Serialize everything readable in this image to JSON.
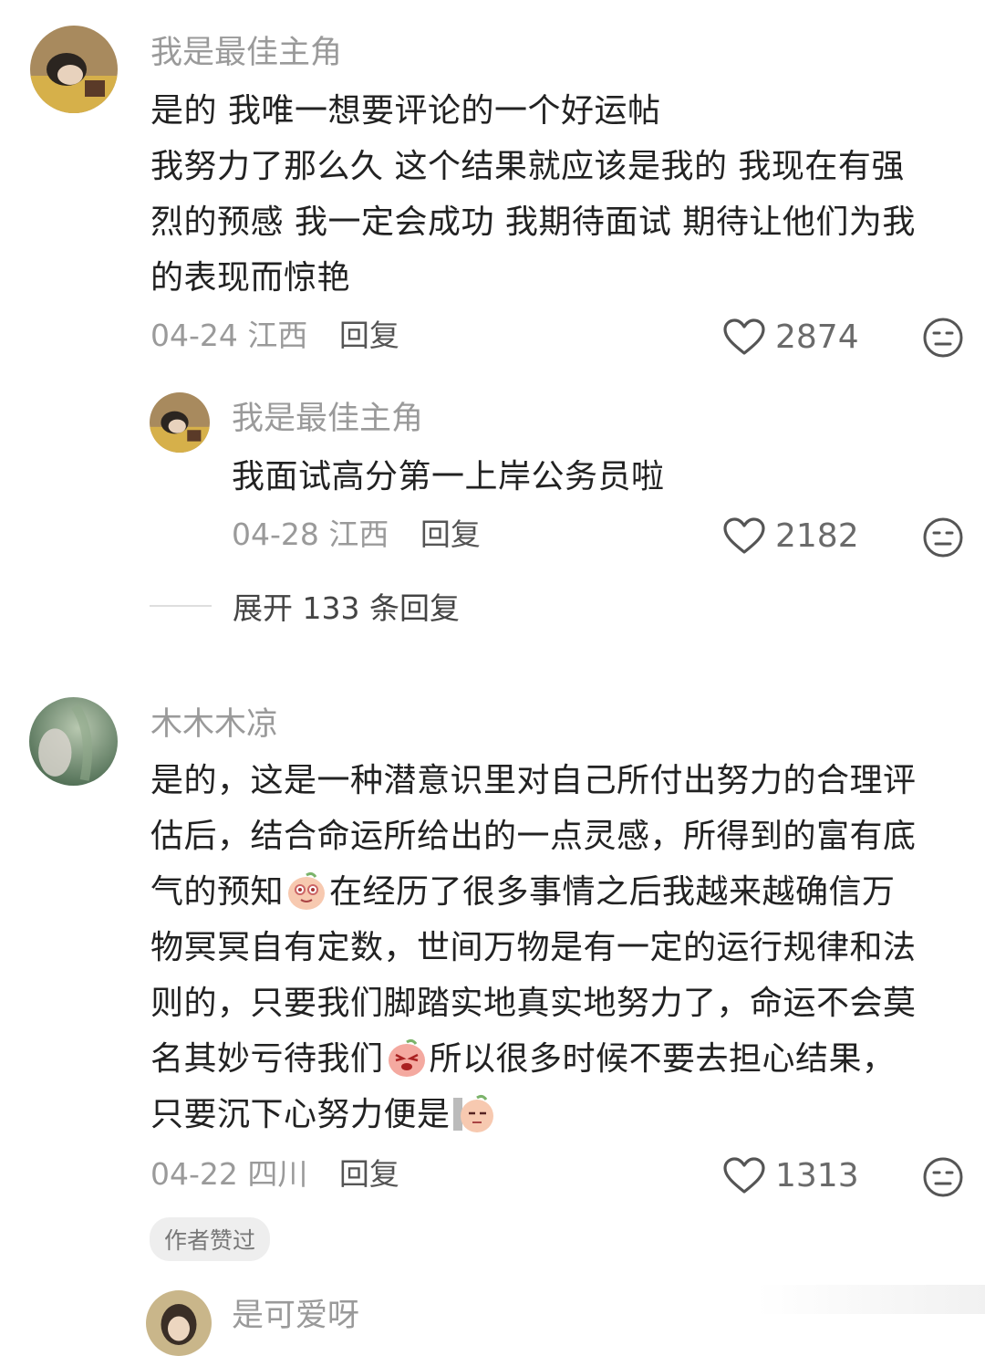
{
  "comments": [
    {
      "username": "我是最佳主角",
      "lines": [
        "是的 我唯一想要评论的一个好运帖",
        "我努力了那么久 这个结果就应该是我的 我现在有强",
        "烈的预感 我一定会成功 我期待面试 期待让他们为我",
        "的表现而惊艳"
      ],
      "date": "04-24",
      "location": "江西",
      "reply_label": "回复",
      "likes": "2874"
    },
    {
      "username": "我是最佳主角",
      "lines": [
        "我面试高分第一上岸公务员啦"
      ],
      "date": "04-28",
      "location": "江西",
      "reply_label": "回复",
      "likes": "2182"
    },
    {
      "username": "木木木凉",
      "line1": "是的，这是一种潜意识里对自己所付出努力的合理评",
      "line2": "估后，结合命运所给出的一点灵感，所得到的富有底",
      "line3a": "气的预知",
      "line3b": "在经历了很多事情之后我越来越确信万",
      "line4": "物冥冥自有定数，世间万物是有一定的运行规律和法",
      "line5": "则的，只要我们脚踏实地真实地努力了，命运不会莫",
      "line6a": "名其妙亏待我们",
      "line6b": "所以很多时候不要去担心结果，",
      "line7": "只要沉下心努力便是",
      "date": "04-22",
      "location": "四川",
      "reply_label": "回复",
      "likes": "1313",
      "badge": "作者赞过"
    },
    {
      "username": "是可爱呀"
    }
  ],
  "expand_replies": "展开 133 条回复",
  "icons": [
    "heart-icon",
    "neutral-face-icon",
    "peach-sticker-icon"
  ]
}
